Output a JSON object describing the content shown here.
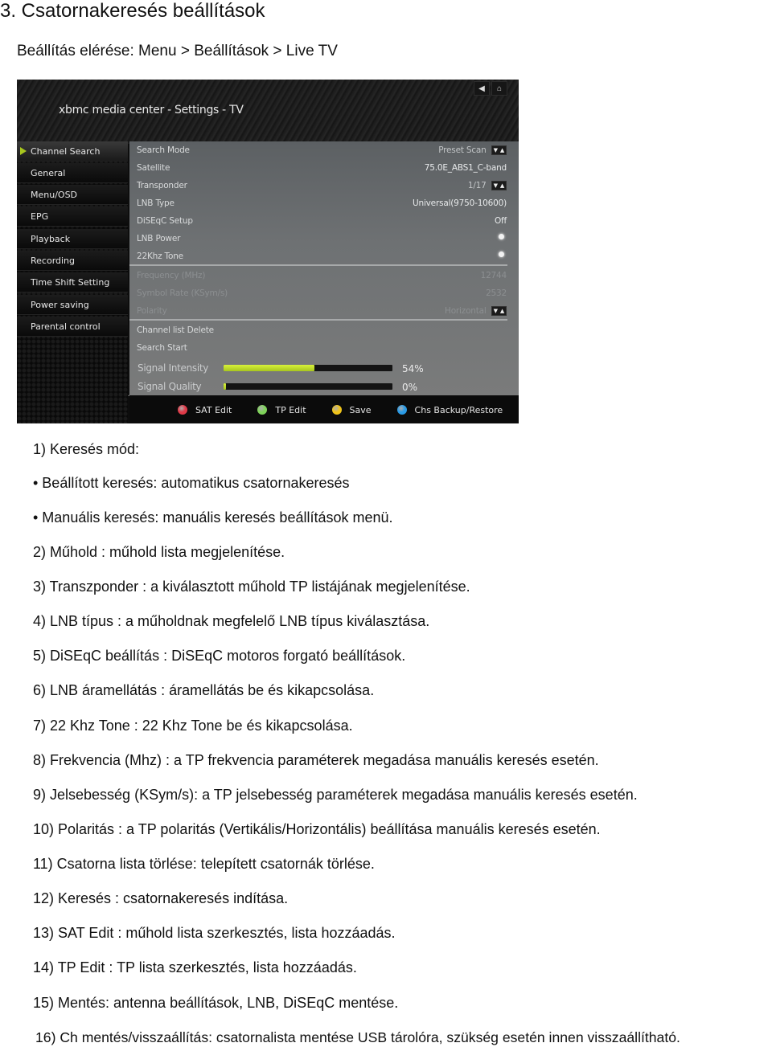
{
  "document": {
    "title": "3. Csatornakeresés beállítások",
    "subtitle": "Beállítás elérése: Menu > Beállítások > Live TV"
  },
  "screenshot": {
    "window_title": "xbmc media center - Settings - TV",
    "nav": {
      "back_icon": "◀",
      "home_icon": "⌂"
    },
    "sidebar": {
      "items": [
        {
          "label": "Channel Search",
          "active": true
        },
        {
          "label": "General"
        },
        {
          "label": "Menu/OSD"
        },
        {
          "label": "EPG"
        },
        {
          "label": "Playback"
        },
        {
          "label": "Recording"
        },
        {
          "label": "Time Shift Setting"
        },
        {
          "label": "Power saving"
        },
        {
          "label": "Parental control"
        }
      ]
    },
    "settings": [
      {
        "label": "Search Mode",
        "value": "Preset Scan",
        "spinner": true
      },
      {
        "label": "Satellite",
        "value": "75.0E_ABS1_C-band"
      },
      {
        "label": "Transponder",
        "value": "1/17",
        "spinner": true
      },
      {
        "label": "LNB Type",
        "value": "Universal(9750-10600)"
      },
      {
        "label": "DiSEqC Setup",
        "value": "Off"
      },
      {
        "label": "LNB Power",
        "value": "radio-on"
      },
      {
        "label": "22Khz Tone",
        "value": "radio-on"
      },
      {
        "label": "Frequency (MHz)",
        "value": "12744",
        "disabled": true
      },
      {
        "label": "Symbol Rate (KSym/s)",
        "value": "2532",
        "disabled": true
      },
      {
        "label": "Polarity",
        "value": "Horizontal",
        "spinner": true,
        "disabled": true
      },
      {
        "label": "Channel list Delete",
        "value": ""
      },
      {
        "label": "Search Start",
        "value": ""
      }
    ],
    "signal": [
      {
        "label": "Signal Intensity",
        "percent": 54,
        "text": "54%"
      },
      {
        "label": "Signal Quality",
        "percent": 0,
        "text": "0%"
      }
    ],
    "footer_buttons": [
      {
        "label": "SAT Edit",
        "color": "#e03a48"
      },
      {
        "label": "TP Edit",
        "color": "#7fd45a"
      },
      {
        "label": "Save",
        "color": "#f0c419"
      },
      {
        "label": "Chs Backup/Restore",
        "color": "#2a9be6"
      }
    ],
    "accent_color": "#a8c61e"
  },
  "descriptions": [
    "1) Keresés mód:",
    "• Beállított keresés: automatikus csatornakeresés",
    "• Manuális keresés: manuális keresés beállítások menü.",
    "2) Műhold : műhold lista megjelenítése.",
    "3) Transzponder : a kiválasztott műhold TP listájának megjelenítése.",
    "4) LNB típus : a műholdnak megfelelő LNB típus kiválasztása.",
    "5) DiSEqC beállítás : DiSEqC motoros forgató beállítások.",
    "6) LNB áramellátás : áramellátás be és kikapcsolása.",
    "7) 22 Khz Tone : 22 Khz Tone be és kikapcsolása.",
    "8) Frekvencia (Mhz) : a TP frekvencia paraméterek megadása manuális keresés esetén.",
    "9) Jelsebesség (KSym/s): a TP jelsebesség paraméterek megadása manuális keresés esetén.",
    "10) Polaritás : a TP polaritás (Vertikális/Horizontális) beállítása manuális keresés esetén.",
    "11) Csatorna lista törlése: telepített csatornák törlése.",
    "12) Keresés : csatornakeresés indítása.",
    "13) SAT Edit : műhold lista szerkesztés, lista hozzáadás.",
    "14) TP Edit : TP lista szerkesztés, lista hozzáadás.",
    "15) Mentés: antenna beállítások, LNB, DiSEqC mentése.",
    "16) Ch mentés/visszaállítás: csatornalista mentése USB tárolóra, szükség esetén innen visszaállítható."
  ]
}
